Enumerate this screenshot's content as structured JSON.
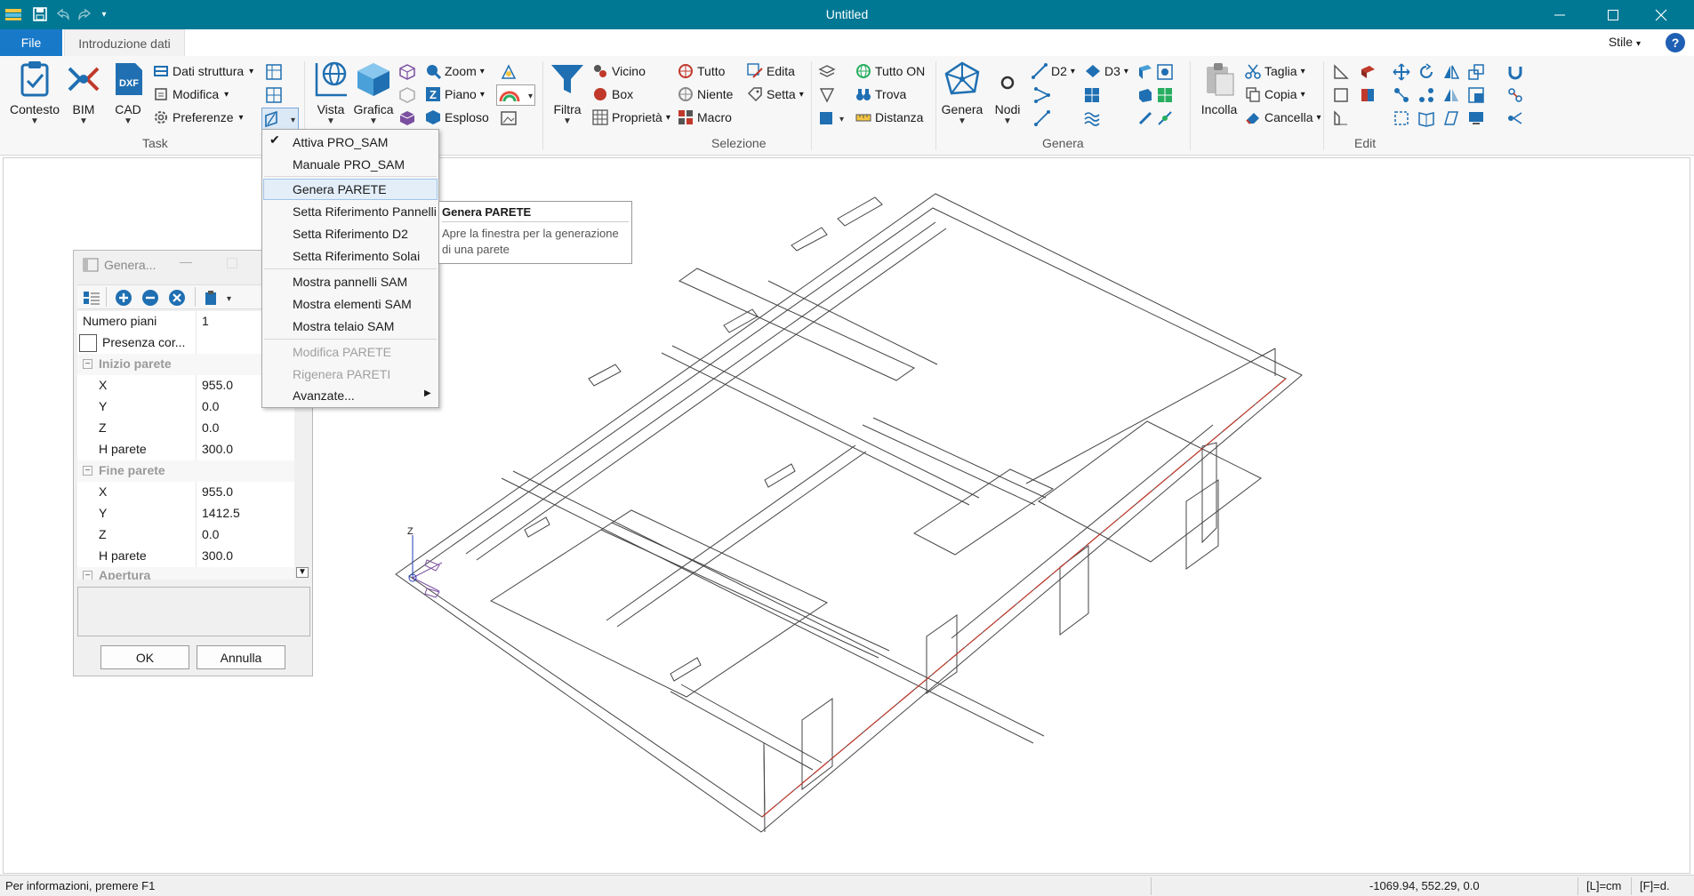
{
  "window": {
    "title": "Untitled",
    "controls": [
      "minimize-icon",
      "maximize-icon",
      "close-icon"
    ]
  },
  "menu": {
    "file_tab": "File",
    "active_tab": "Introduzione dati",
    "style_label": "Stile",
    "help_label": "?"
  },
  "ribbon": {
    "task": {
      "label": "Task",
      "contesto": "Contesto",
      "bim": "BIM",
      "cad": "CAD",
      "cad_icon_text": "DXF",
      "dati_struttura": "Dati struttura",
      "modifica": "Modifica",
      "preferenze": "Preferenze"
    },
    "view": {
      "vista": "Vista",
      "grafica": "Grafica",
      "zoom": "Zoom",
      "piano": "Piano",
      "esploso": "Esploso"
    },
    "selezione": {
      "label": "Selezione",
      "filtra": "Filtra",
      "vicino": "Vicino",
      "box": "Box",
      "proprieta": "Proprietà",
      "tutto": "Tutto",
      "niente": "Niente",
      "macro": "Macro",
      "edita": "Edita",
      "setta": "Setta",
      "tutto_on": "Tutto ON",
      "trova": "Trova",
      "distanza": "Distanza"
    },
    "genera": {
      "label": "Genera",
      "genera": "Genera",
      "nodi": "Nodi",
      "d2": "D2",
      "d3": "D3"
    },
    "edit": {
      "label": "Edit",
      "incolla": "Incolla",
      "taglia": "Taglia",
      "copia": "Copia",
      "cancella": "Cancella"
    }
  },
  "dropdown": {
    "items": [
      {
        "label": "Attiva  PRO_SAM",
        "checked": true,
        "enabled": true
      },
      {
        "label": "Manuale PRO_SAM",
        "enabled": true
      },
      {
        "label": "Genera PARETE",
        "enabled": true,
        "highlighted": true
      },
      {
        "label": "Setta Riferimento Pannelli",
        "enabled": true
      },
      {
        "label": "Setta Riferimento D2",
        "enabled": true
      },
      {
        "label": "Setta Riferimento Solai",
        "enabled": true
      },
      {
        "label": "Mostra pannelli SAM",
        "enabled": true
      },
      {
        "label": "Mostra elementi SAM",
        "enabled": true
      },
      {
        "label": "Mostra telaio SAM",
        "enabled": true
      },
      {
        "label": "Modifica PARETE",
        "enabled": false
      },
      {
        "label": "Rigenera PARETI",
        "enabled": false
      },
      {
        "label": "Avanzate...",
        "enabled": true,
        "submenu": true
      }
    ]
  },
  "tooltip": {
    "title": "Genera PARETE",
    "body": "Apre la finestra per la generazione di una parete"
  },
  "panel": {
    "title": "Genera...",
    "rows": {
      "numero_piani": {
        "label": "Numero piani",
        "value": "1"
      },
      "presenza": {
        "label": "Presenza cor...",
        "checked": false
      }
    },
    "inizio": {
      "label": "Inizio parete",
      "x": {
        "label": "X",
        "value": "955.0"
      },
      "y": {
        "label": "Y",
        "value": "0.0"
      },
      "z": {
        "label": "Z",
        "value": "0.0"
      },
      "h": {
        "label": "H parete",
        "value": "300.0"
      }
    },
    "fine": {
      "label": "Fine parete",
      "x": {
        "label": "X",
        "value": "955.0"
      },
      "y": {
        "label": "Y",
        "value": "1412.5"
      },
      "z": {
        "label": "Z",
        "value": "0.0"
      },
      "h": {
        "label": "H parete",
        "value": "300.0"
      }
    },
    "apertura_label": "Apertura",
    "ok": "OK",
    "annulla": "Annulla"
  },
  "axis": {
    "z_label": "Z"
  },
  "status": {
    "info": "Per informazioni, premere F1",
    "coords": "-1069.94, 552.29, 0.0",
    "units": "[L]=cm",
    "force": "[F]=d."
  },
  "colors": {
    "titlebar": "#007894",
    "file_tab": "#1879c8",
    "icon_blue": "#1f6fb2",
    "wall_red": "#c0392b"
  }
}
